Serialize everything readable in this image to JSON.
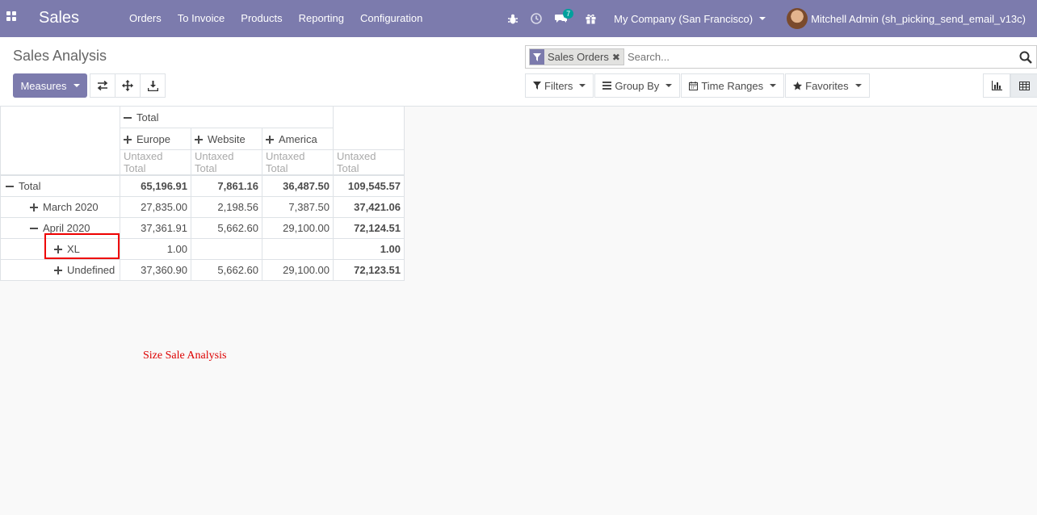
{
  "navbar": {
    "app_name": "Sales",
    "menu": [
      "Orders",
      "To Invoice",
      "Products",
      "Reporting",
      "Configuration"
    ],
    "messages_count": "7",
    "company": "My Company (San Francisco)",
    "user": "Mitchell Admin (sh_picking_send_email_v13c)",
    "background": "#7c7bad"
  },
  "control_panel": {
    "title": "Sales Analysis",
    "facet_label": "Sales Orders",
    "search_placeholder": "Search...",
    "measures_label": "Measures",
    "filters_label": "Filters",
    "group_by_label": "Group By",
    "time_ranges_label": "Time Ranges",
    "favorites_label": "Favorites"
  },
  "pivot": {
    "top_header": "Total",
    "columns": [
      "Europe",
      "Website",
      "America"
    ],
    "measure": "Untaxed Total",
    "rows": [
      {
        "label": "Total",
        "values": [
          "65,196.91",
          "7,861.16",
          "36,487.50"
        ],
        "total": "109,545.57"
      },
      {
        "label": "March 2020",
        "values": [
          "27,835.00",
          "2,198.56",
          "7,387.50"
        ],
        "total": "37,421.06"
      },
      {
        "label": "April 2020",
        "values": [
          "37,361.91",
          "5,662.60",
          "29,100.00"
        ],
        "total": "72,124.51"
      },
      {
        "label": "XL",
        "values": [
          "1.00",
          "",
          ""
        ],
        "total": "1.00"
      },
      {
        "label": "Undefined",
        "values": [
          "37,360.90",
          "5,662.60",
          "29,100.00"
        ],
        "total": "72,123.51"
      }
    ]
  },
  "annotation": "Size Sale Analysis"
}
